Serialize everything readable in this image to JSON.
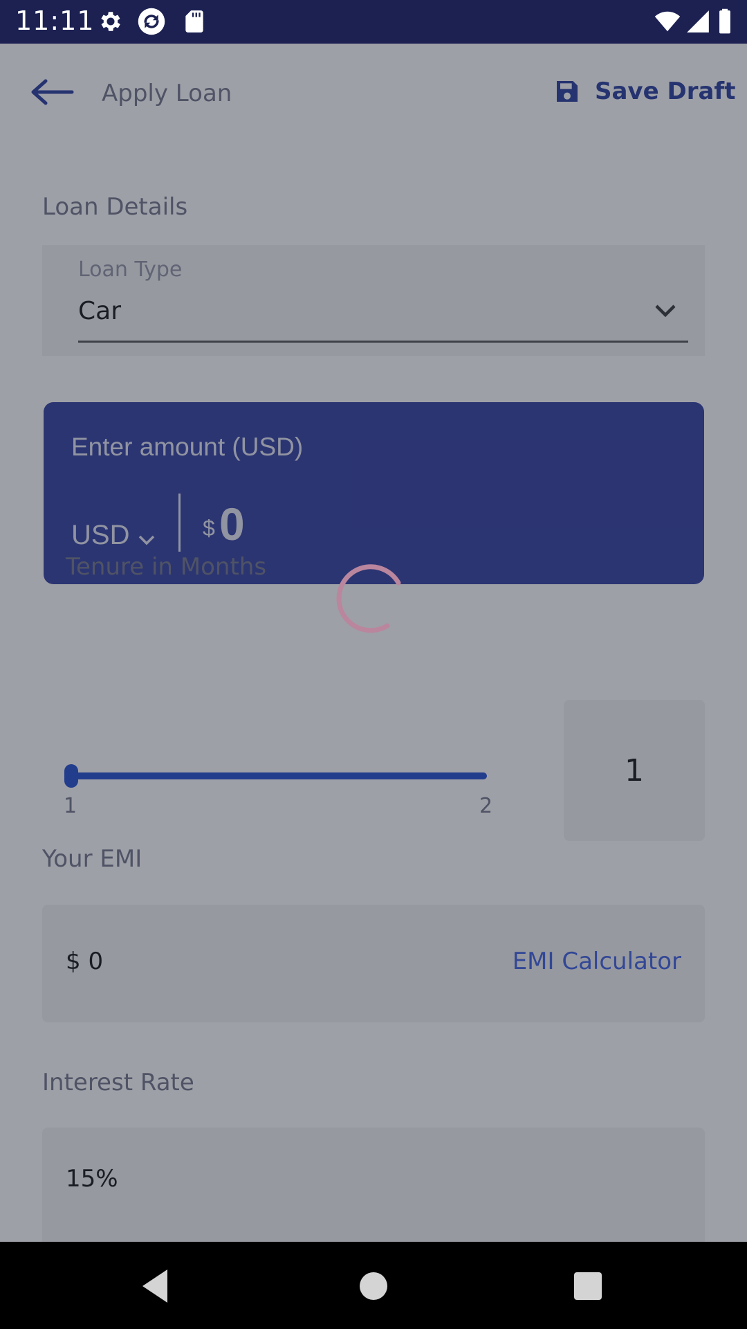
{
  "status_bar": {
    "time": "11:11",
    "icons": [
      "gear-icon",
      "sync-icon",
      "sd-card-icon",
      "wifi-icon",
      "signal-icon",
      "battery-icon"
    ]
  },
  "header": {
    "back_icon": "arrow-left-icon",
    "title": "Apply Loan",
    "save_icon": "floppy-disk-icon",
    "save_label": "Save Draft"
  },
  "loan_details": {
    "section_label": "Loan Details",
    "loan_type_label": "Loan Type",
    "loan_type_value": "Car"
  },
  "amount": {
    "label": "Enter amount (USD)",
    "currency": "USD",
    "symbol": "$",
    "value": "0"
  },
  "tenure": {
    "label": "Tenure in Months",
    "min": "1",
    "max": "2",
    "current": "1",
    "slider_position": 0
  },
  "emi": {
    "label": "Your EMI",
    "value": "$ 0",
    "calculator_link": "EMI Calculator"
  },
  "interest": {
    "label": "Interest Rate",
    "value": "15%"
  },
  "loading": {
    "indicator": "spinner"
  },
  "colors": {
    "status_bar": "#1c2152",
    "accent": "#243a9c",
    "amount_card": "#2f3c9f",
    "slider": "#1f4cd0",
    "link": "#3b5ee0",
    "spinner": "#e07aa0"
  },
  "nav_bar": {
    "icons": [
      "back-triangle-icon",
      "home-circle-icon",
      "recents-square-icon"
    ]
  }
}
